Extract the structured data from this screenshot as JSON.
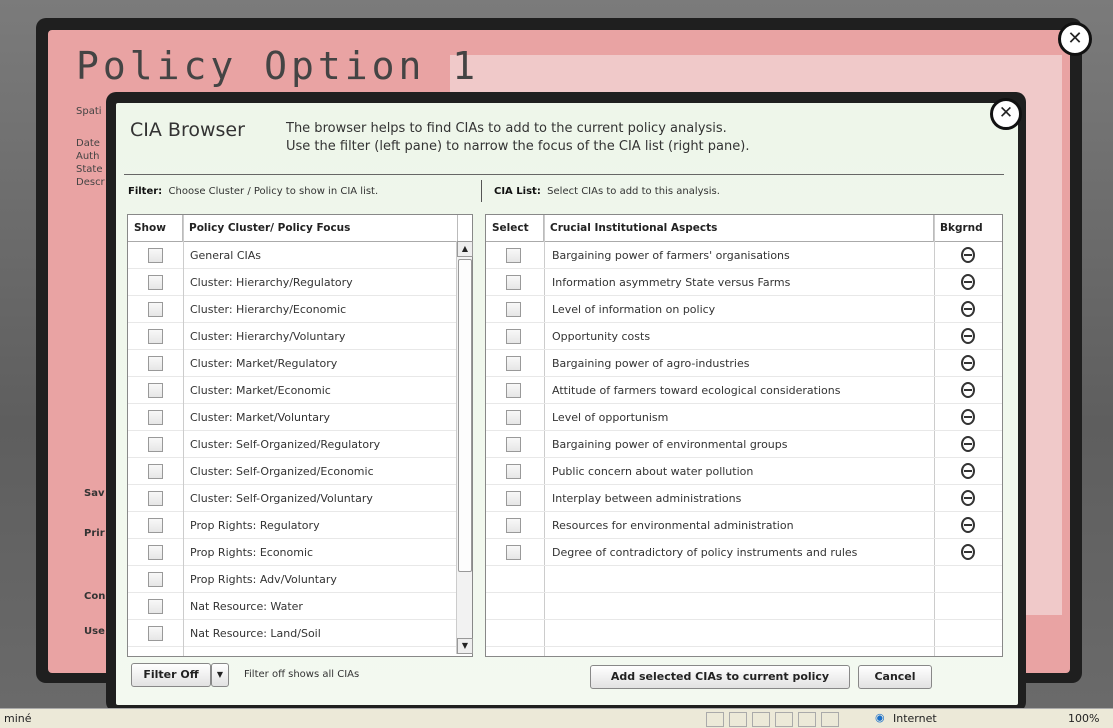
{
  "outer": {
    "title": "Policy Option 1",
    "meta": [
      "Spati",
      "Date",
      "Auth",
      "State",
      "Descr"
    ],
    "side": [
      "Sav",
      "Prir",
      "Con",
      "Use"
    ],
    "close": "✕"
  },
  "dialog": {
    "title": "CIA Browser",
    "desc_line1": "The browser helps to find CIAs to add to the current policy analysis.",
    "desc_line2": "Use the filter (left pane) to narrow the focus of the CIA list (right pane).",
    "close": "✕",
    "filter_label": "Filter:",
    "filter_text": "Choose Cluster / Policy to show in CIA list.",
    "cia_label": "CIA List:",
    "cia_text": "Select CIAs to add to this analysis."
  },
  "left": {
    "col_show": "Show",
    "col_focus": "Policy Cluster/ Policy Focus",
    "rows": [
      "General CIAs",
      "Cluster: Hierarchy/Regulatory",
      "Cluster: Hierarchy/Economic",
      "Cluster: Hierarchy/Voluntary",
      "Cluster: Market/Regulatory",
      "Cluster: Market/Economic",
      "Cluster: Market/Voluntary",
      "Cluster: Self-Organized/Regulatory",
      "Cluster: Self-Organized/Economic",
      "Cluster: Self-Organized/Voluntary",
      "Prop Rights: Regulatory",
      "Prop Rights: Economic",
      "Prop Rights: Adv/Voluntary",
      "Nat Resource: Water",
      "Nat Resource: Land/Soil"
    ]
  },
  "right": {
    "col_select": "Select",
    "col_aspects": "Crucial Institutional Aspects",
    "col_bkg": "Bkgrnd",
    "rows": [
      "Bargaining power of farmers' organisations",
      "Information asymmetry State versus Farms",
      "Level of information on policy",
      "Opportunity costs",
      "Bargaining power of agro-industries",
      "Attitude of farmers toward ecological considerations",
      "Level of opportunism",
      "Bargaining power of environmental groups",
      "Public concern about water pollution",
      "Interplay between administrations",
      "Resources for environmental administration",
      "Degree of contradictory of policy instruments and rules"
    ]
  },
  "footer": {
    "filter_off": "Filter Off",
    "filter_note": "Filter off shows all CIAs",
    "add": "Add selected CIAs to current policy",
    "cancel": "Cancel"
  },
  "status": {
    "left": "miné",
    "zone": "Internet",
    "zoom": "100%"
  }
}
